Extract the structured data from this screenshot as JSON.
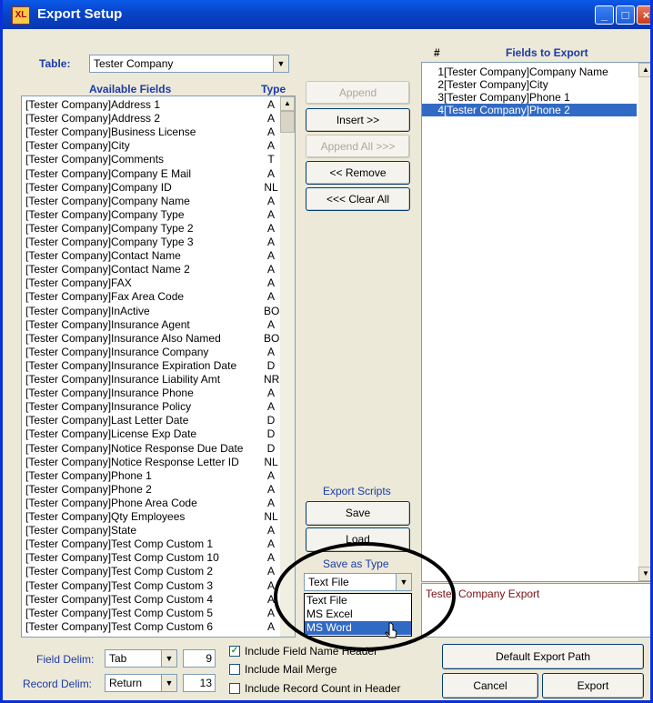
{
  "window": {
    "title": "Export Setup",
    "icon_text": "XL"
  },
  "table": {
    "label": "Table:",
    "value": "Tester Company"
  },
  "available": {
    "header_fields": "Available Fields",
    "header_type": "Type",
    "rows": [
      {
        "name": "[Tester Company]Address 1",
        "type": "A"
      },
      {
        "name": "[Tester Company]Address 2",
        "type": "A"
      },
      {
        "name": "[Tester Company]Business License",
        "type": "A"
      },
      {
        "name": "[Tester Company]City",
        "type": "A"
      },
      {
        "name": "[Tester Company]Comments",
        "type": "T"
      },
      {
        "name": "[Tester Company]Company E Mail",
        "type": "A"
      },
      {
        "name": "[Tester Company]Company ID",
        "type": "NL"
      },
      {
        "name": "[Tester Company]Company Name",
        "type": "A"
      },
      {
        "name": "[Tester Company]Company Type",
        "type": "A"
      },
      {
        "name": "[Tester Company]Company Type 2",
        "type": "A"
      },
      {
        "name": "[Tester Company]Company Type 3",
        "type": "A"
      },
      {
        "name": "[Tester Company]Contact Name",
        "type": "A"
      },
      {
        "name": "[Tester Company]Contact Name 2",
        "type": "A"
      },
      {
        "name": "[Tester Company]FAX",
        "type": "A"
      },
      {
        "name": "[Tester Company]Fax Area Code",
        "type": "A"
      },
      {
        "name": "[Tester Company]InActive",
        "type": "BO"
      },
      {
        "name": "[Tester Company]Insurance Agent",
        "type": "A"
      },
      {
        "name": "[Tester Company]Insurance Also Named",
        "type": "BO"
      },
      {
        "name": "[Tester Company]Insurance Company",
        "type": "A"
      },
      {
        "name": "[Tester Company]Insurance Expiration Date",
        "type": "D"
      },
      {
        "name": "[Tester Company]Insurance Liability Amt",
        "type": "NR"
      },
      {
        "name": "[Tester Company]Insurance Phone",
        "type": "A"
      },
      {
        "name": "[Tester Company]Insurance Policy",
        "type": "A"
      },
      {
        "name": "[Tester Company]Last Letter Date",
        "type": "D"
      },
      {
        "name": "[Tester Company]License Exp Date",
        "type": "D"
      },
      {
        "name": "[Tester Company]Notice Response Due Date",
        "type": "D"
      },
      {
        "name": "[Tester Company]Notice Response Letter ID",
        "type": "NL"
      },
      {
        "name": "[Tester Company]Phone 1",
        "type": "A"
      },
      {
        "name": "[Tester Company]Phone 2",
        "type": "A"
      },
      {
        "name": "[Tester Company]Phone Area Code",
        "type": "A"
      },
      {
        "name": "[Tester Company]Qty Employees",
        "type": "NL"
      },
      {
        "name": "[Tester Company]State",
        "type": "A"
      },
      {
        "name": "[Tester Company]Test Comp Custom 1",
        "type": "A"
      },
      {
        "name": "[Tester Company]Test Comp Custom 10",
        "type": "A"
      },
      {
        "name": "[Tester Company]Test Comp Custom 2",
        "type": "A"
      },
      {
        "name": "[Tester Company]Test Comp Custom 3",
        "type": "A"
      },
      {
        "name": "[Tester Company]Test Comp Custom 4",
        "type": "A"
      },
      {
        "name": "[Tester Company]Test Comp Custom 5",
        "type": "A"
      },
      {
        "name": "[Tester Company]Test Comp Custom 6",
        "type": "A"
      }
    ]
  },
  "buttons": {
    "append": "Append",
    "insert": "Insert >>",
    "append_all": "Append All >>>",
    "remove": "<< Remove",
    "clear_all": "<<< Clear All",
    "export_scripts": "Export Scripts",
    "save": "Save",
    "load": "Load",
    "save_as_type": "Save as Type",
    "default_export_path": "Default Export Path",
    "cancel": "Cancel",
    "export": "Export"
  },
  "save_type": {
    "value": "Text File",
    "options": [
      "Text File",
      "MS Excel",
      "MS Word"
    ],
    "selected_index": 2
  },
  "export_fields": {
    "header_num": "#",
    "header_fields": "Fields to Export",
    "rows": [
      {
        "num": "1",
        "name": "[Tester Company]Company Name"
      },
      {
        "num": "2",
        "name": "[Tester Company]City"
      },
      {
        "num": "3",
        "name": "[Tester Company]Phone 1"
      },
      {
        "num": "4",
        "name": "[Tester Company]Phone 2"
      }
    ],
    "selected_index": 3
  },
  "export_name": "Tester Company Export",
  "delims": {
    "field_label": "Field Delim:",
    "field_value": "Tab",
    "field_code": "9",
    "record_label": "Record Delim:",
    "record_value": "Return",
    "record_code": "13"
  },
  "options": {
    "include_field_names": "Include Field Name Header",
    "include_mail_merge": "Include Mail Merge",
    "include_record_count": "Include Record Count in Header"
  }
}
